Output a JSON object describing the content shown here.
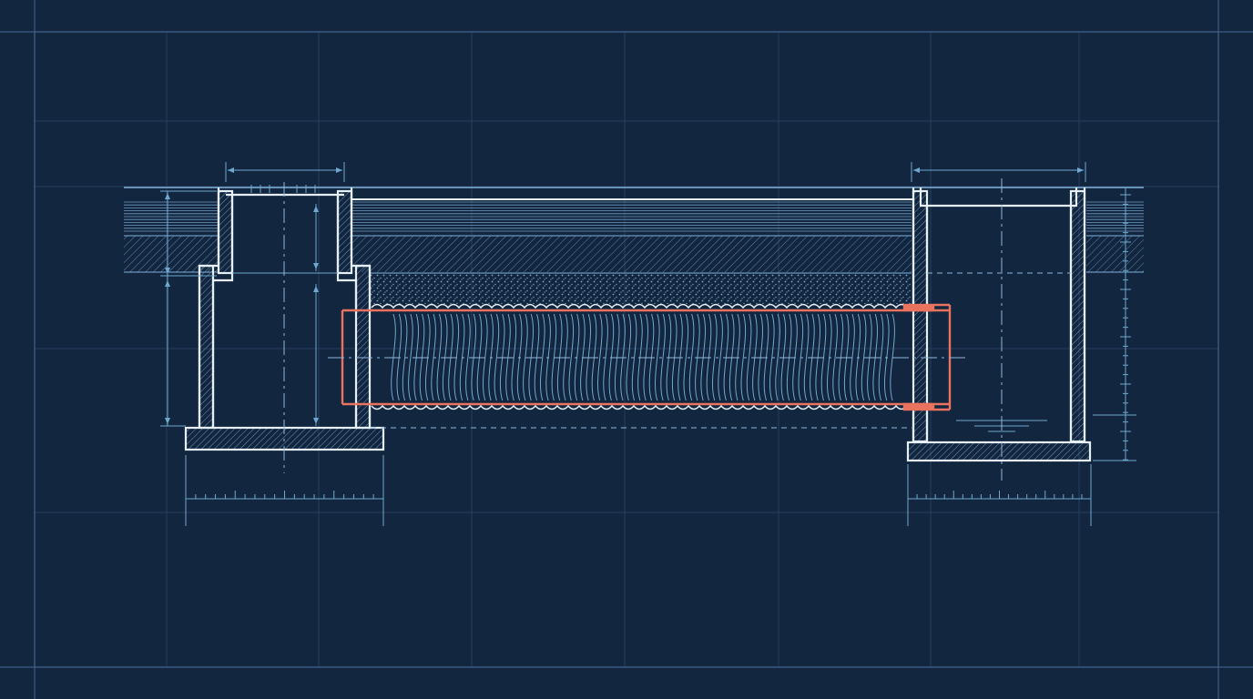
{
  "drawing": {
    "title": "",
    "labels": []
  },
  "colors": {
    "background": "#13263f",
    "grid": "#2a4666",
    "frame": "#3d5d82",
    "linework": "#e6eef6",
    "dimension": "#6fa8cf",
    "hatch": "#5b87ad",
    "pipe": "#e9735f",
    "fill_dots": "#7fa7c9"
  },
  "elements": {
    "inlet_chamber": "inlet-chamber",
    "outlet_chamber": "outlet-chamber",
    "corrugated_pipe": "corrugated-pipe",
    "backfill_layer": "backfill-layer",
    "ground_layers": "ground-layers"
  }
}
